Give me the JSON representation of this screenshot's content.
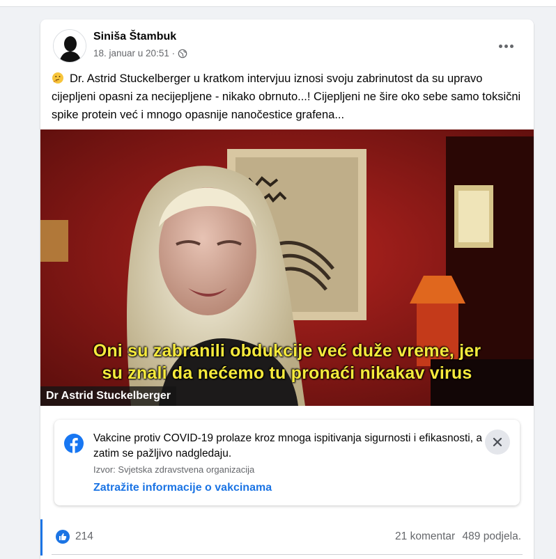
{
  "post": {
    "author": "Siniša Štambuk",
    "timestamp": "18. januar u 20:51 ·",
    "audience_icon": "globe-icon",
    "emoji_icon": "thinking-face-emoji",
    "text": "Dr. Astrid Stuckelberger u kratkom intervjuu iznosi svoju zabrinutost da su upravo cijepljeni opasni za necijepljene - nikako obrnuto...! Cijepljeni ne šire oko sebe samo toksični spike protein već i mnogo opasnije nanočestice grafena..."
  },
  "video": {
    "subtitle_line1": "Oni su zabranili obdukcije već duže vreme, jer",
    "subtitle_line2": "su znali da nećemo tu pronaći nikakav virus",
    "name_caption": "Dr Astrid Stuckelberger"
  },
  "info_box": {
    "icon": "facebook-logo-icon",
    "text": "Vakcine protiv COVID-19 prolaze kroz mnoga ispitivanja sigurnosti i efikasnosti, a zatim se pažljivo nadgledaju.",
    "source": "Izvor: Svjetska zdravstvena organizacija",
    "link": "Zatražite informacije o vakcinama",
    "close_icon": "close-icon"
  },
  "stats": {
    "like_icon": "like-icon",
    "likes": "214",
    "comments": "21 komentar",
    "shares": "489 podjela."
  },
  "colors": {
    "accent": "#1b74e4",
    "subtitle": "#f6ea3c",
    "video_bg": "#7a1512"
  }
}
